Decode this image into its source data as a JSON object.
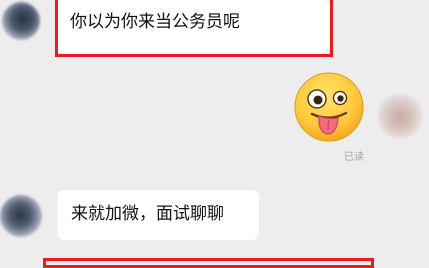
{
  "messages": [
    {
      "side": "left",
      "text": "你以为你来当公务员呢"
    },
    {
      "side": "right",
      "type": "sticker",
      "sticker": "silly-face-tongue-out",
      "status": "已读"
    },
    {
      "side": "left",
      "text": "来就加微，面试聊聊"
    }
  ],
  "colors": {
    "background": "#ededed",
    "bubble": "#ffffff",
    "highlight": "#ef1b1b",
    "read_status": "#a5a5a5"
  }
}
